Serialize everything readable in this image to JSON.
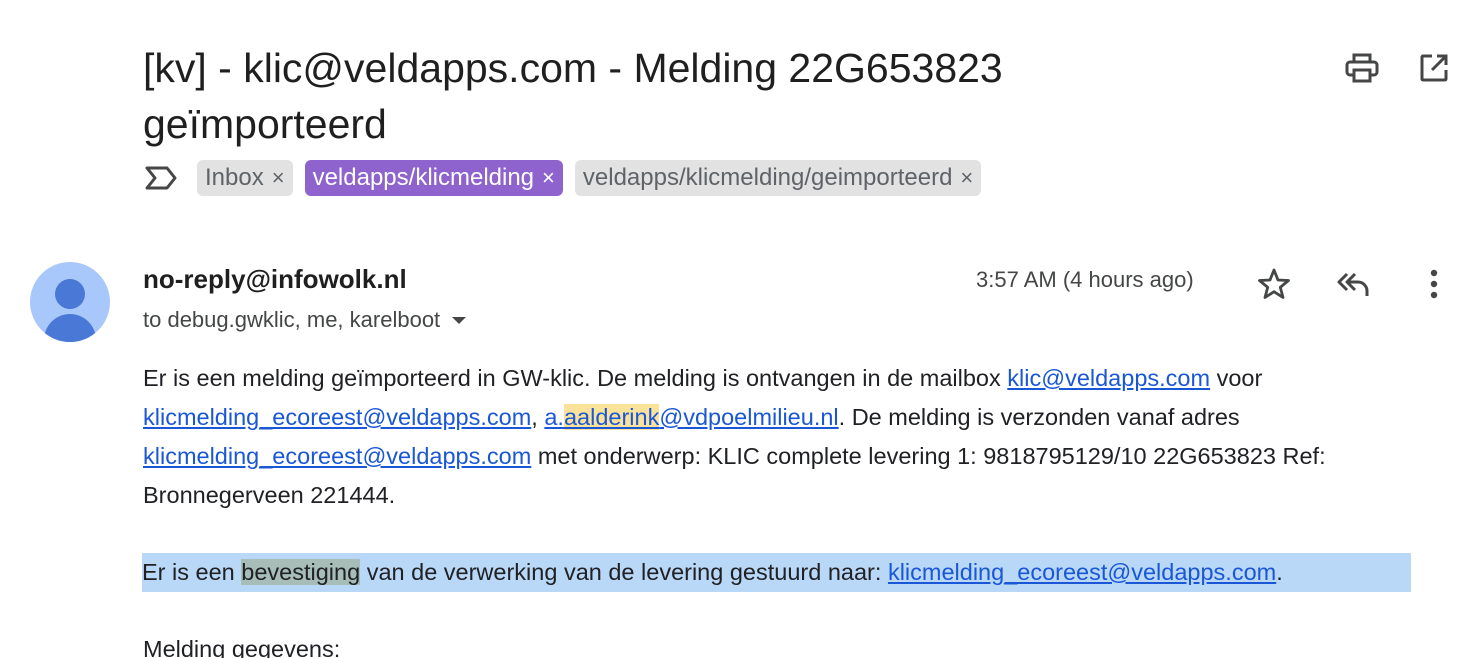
{
  "email": {
    "subject": "[kv] - klic@veldapps.com - Melding 22G653823 geïmporteerd",
    "labels": [
      {
        "name": "Inbox",
        "color": "#e2e2e2"
      },
      {
        "name": "veldapps/klicmelding",
        "color": "#8e63ce"
      },
      {
        "name": "veldapps/klicmelding/geimporteerd",
        "color": "#e2e2e2"
      }
    ],
    "chip_close_glyph": "×",
    "sender": "no-reply@infowolk.nl",
    "recipients": "to debug.gwklic, me, karelboot",
    "timestamp": "3:57 AM (4 hours ago)",
    "icons": {
      "print": "print-icon",
      "popout": "open-in-new-window-icon",
      "important": "important-marker-icon",
      "star": "star-icon",
      "reply_all": "reply-all-icon",
      "more": "more-vertical-icon",
      "avatar": "default-avatar-icon"
    }
  },
  "body": {
    "p1": {
      "t1": "Er is een melding geïmporteerd in GW-klic. De melding is ontvangen in de mailbox ",
      "link1": "klic@veldapps.com",
      "t2": " voor ",
      "link2": "klicmelding_ecoreest@veldapps.com",
      "t3": ", ",
      "link3_a": "a.",
      "link3_b": "aalderink",
      "link3_c": "@vdpoelmilieu.nl",
      "t4": ". De melding is verzonden vanaf adres ",
      "link4": "klicmelding_ecoreest@veldapps.com",
      "t5": " met onderwerp: KLIC complete levering 1: 9818795129/10 22G653823 Ref: Bronnegerveen 221444."
    },
    "p2": {
      "t1": "Er is een ",
      "highlight": "bevestiging",
      "t2": " van de verwerking van de levering gestuurd naar: ",
      "link": "klicmelding_ecoreest@veldapps.com",
      "t3": "."
    },
    "p3": "Melding gegevens:"
  },
  "colors": {
    "link": "#1a57d6",
    "selection": "#b9d7f7",
    "search_highlight": "#fbe29a",
    "label_purple": "#8e63ce",
    "avatar_bg": "#a8c7fa"
  }
}
